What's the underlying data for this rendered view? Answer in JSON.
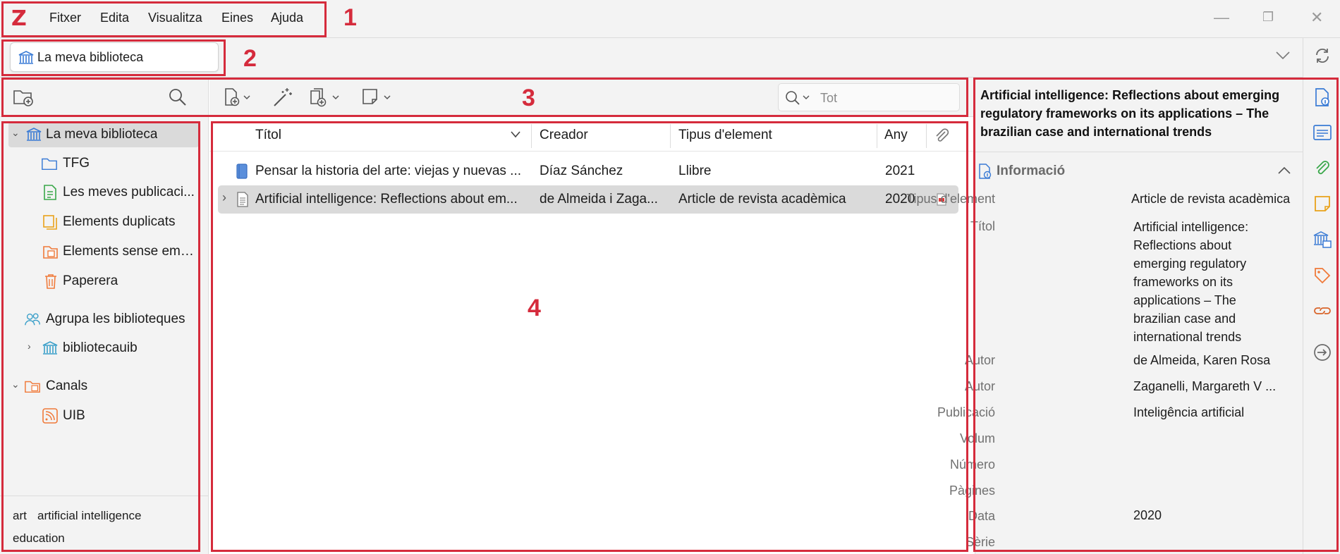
{
  "app": {
    "logo": "Z"
  },
  "menu": [
    "Fitxer",
    "Edita",
    "Visualitza",
    "Eines",
    "Ajuda"
  ],
  "library_tab": {
    "label": "La meva biblioteca"
  },
  "annotations": [
    "1",
    "2",
    "3",
    "4"
  ],
  "collections": {
    "library": "La meva biblioteca",
    "items": [
      {
        "label": "TFG",
        "icon": "folder-icon"
      },
      {
        "label": "Les meves publicaci...",
        "icon": "my-publications-icon"
      },
      {
        "label": "Elements duplicats",
        "icon": "duplicates-icon"
      },
      {
        "label": "Elements sense emp...",
        "icon": "unfiled-icon"
      },
      {
        "label": "Paperera",
        "icon": "trash-icon"
      }
    ],
    "group_header": "Agrupa les biblioteques",
    "group": "bibliotecauib",
    "feeds_header": "Canals",
    "feed": "UIB"
  },
  "tags": [
    "art",
    "artificial intelligence",
    "education"
  ],
  "search": {
    "placeholder": "Tot"
  },
  "items_table": {
    "columns": [
      "Títol",
      "Creador",
      "Tipus d'element",
      "Any"
    ],
    "rows": [
      {
        "title": "Pensar la historia del arte: viejas y nuevas ...",
        "creator": "Díaz Sánchez",
        "type": "Llibre",
        "year": "2021"
      },
      {
        "title": "Artificial intelligence: Reflections about em...",
        "creator": "de Almeida i Zaga...",
        "type": "Article de revista acadèmica",
        "year": "2020"
      }
    ]
  },
  "item_pane": {
    "header_title": "Artificial intelligence: Reflections about emerging regulatory frameworks on its applications – The brazilian case and international trends",
    "section_title": "Informació",
    "fields": {
      "item_type_label": "Tipus d'element",
      "item_type": "Article de revista acadèmica",
      "title_label": "Títol",
      "title": "Artificial intelligence: Reflections about emerging regulatory frameworks on its applications – The brazilian case and international trends",
      "author_label": "Autor",
      "author1": "de Almeida, Karen Rosa",
      "author2": "Zaganelli, Margareth V ...",
      "publication_label": "Publicació",
      "publication": "Inteligência artificial",
      "volume_label": "Volum",
      "issue_label": "Número",
      "pages_label": "Pàgines",
      "date_label": "Data",
      "date": "2020",
      "series_label": "Sèrie"
    }
  },
  "colors": {
    "annotation": "#d52b3c",
    "selection": "#dadada",
    "logo": "#d52b3c",
    "accent": "#3a7bd5"
  }
}
